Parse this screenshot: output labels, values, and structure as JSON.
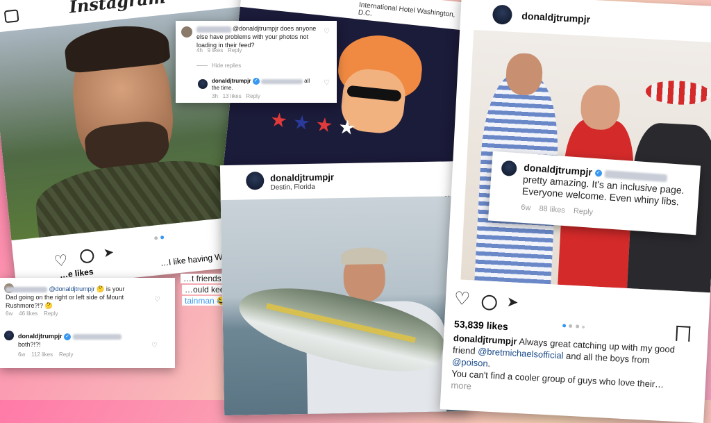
{
  "card_left": {
    "app_name": "Instagram",
    "likes_partial": "…e likes",
    "caption_partial_1": "…I like having WiFi after a week",
    "caption_partial_2": "…t friends. I brough",
    "caption_partial_3": "…ould keep it???",
    "caption_partial_4": "tainman 😂💪"
  },
  "comment_top": {
    "text": "@donaldjtrumpjr does anyone else have problems with your photos not loading in their feed?",
    "time": "4h",
    "likes": "9 likes",
    "reply": "Reply",
    "hide_replies": "Hide replies",
    "reply_user": "donaldjtrumpjr",
    "reply_text_1": "all",
    "reply_text_2": "the time.",
    "reply_time": "3h",
    "reply_likes": "13 likes",
    "reply_reply": "Reply"
  },
  "card_middle_top": {
    "location_partial": "International Hotel Washington, D.C."
  },
  "card_middle": {
    "user": "donaldjtrumpjr",
    "location": "Destin, Florida",
    "more": "•••"
  },
  "card_right": {
    "user": "donaldjtrumpjr",
    "likes": "53,839 likes",
    "caption_user": "donaldjtrumpjr",
    "caption_1": "Always great catching up with my good",
    "caption_2a": "friend ",
    "caption_mention1": "@bretmichaelsofficial",
    "caption_2b": " and all the boys from ",
    "caption_mention2": "@poison",
    "caption_2c": ".",
    "caption_3": "You can't find a cooler group of guys who love their…",
    "caption_more": "more"
  },
  "comment_right": {
    "user": "donaldjtrumpjr",
    "text_1": "pretty amazing. It's an inclusive page.",
    "text_2": "Everyone welcome. Even whiny libs.",
    "time": "6w",
    "likes": "88 likes",
    "reply": "Reply"
  },
  "comment_bottom_left": {
    "mention": "@donaldjtrumpjr",
    "text_1": "🤔 is your",
    "text_2": "Dad going on the right or left side of Mount",
    "text_3": "Rushmore?!? 🤔",
    "time": "6w",
    "likes": "46 likes",
    "reply": "Reply",
    "reply_user": "donaldjtrumpjr",
    "reply_text": "both?!?!",
    "reply_time": "6w",
    "reply_likes": "112 likes",
    "reply_reply": "Reply"
  }
}
